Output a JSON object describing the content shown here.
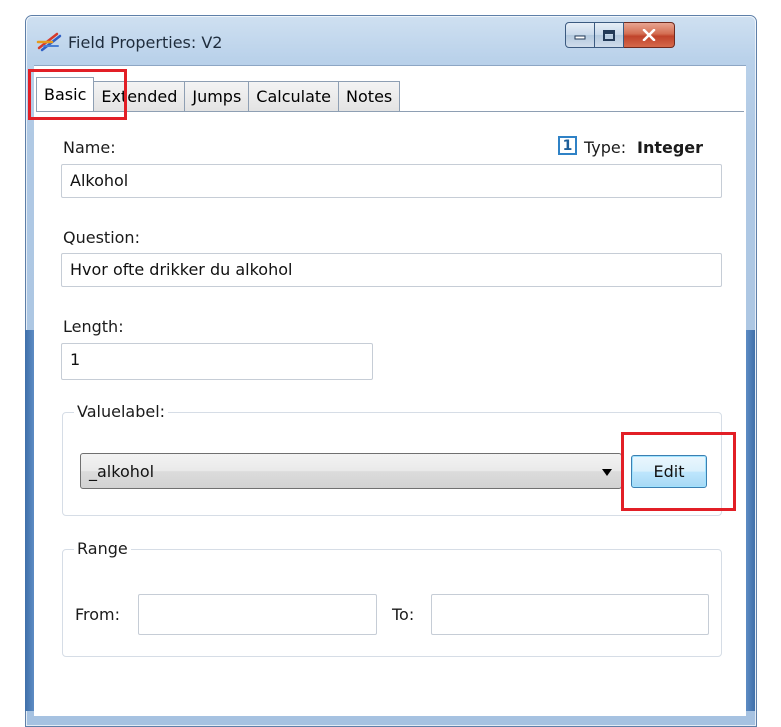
{
  "window": {
    "title": "Field Properties: V2"
  },
  "tabs": [
    {
      "label": "Basic"
    },
    {
      "label": "Extended"
    },
    {
      "label": "Jumps"
    },
    {
      "label": "Calculate"
    },
    {
      "label": "Notes"
    }
  ],
  "basic": {
    "name_label": "Name:",
    "name_value": "Alkohol",
    "type_badge": "1",
    "type_label": "Type:",
    "type_value": "Integer",
    "question_label": "Question:",
    "question_value": "Hvor ofte drikker du alkohol",
    "length_label": "Length:",
    "length_value": "1",
    "valuelabel_group": "Valuelabel:",
    "valuelabel_selected": "_alkohol",
    "edit_button": "Edit",
    "range_group": "Range",
    "from_label": "From:",
    "from_value": "",
    "to_label": "To:",
    "to_value": ""
  },
  "colors": {
    "highlight": "#e21f26",
    "frame": "#b9d1ea",
    "type_badge": "#2f82c6"
  },
  "icons": {
    "app": "field-properties-icon",
    "minimize": "minimize-icon",
    "maximize": "maximize-icon",
    "close": "close-icon",
    "dropdown": "chevron-down-icon"
  }
}
